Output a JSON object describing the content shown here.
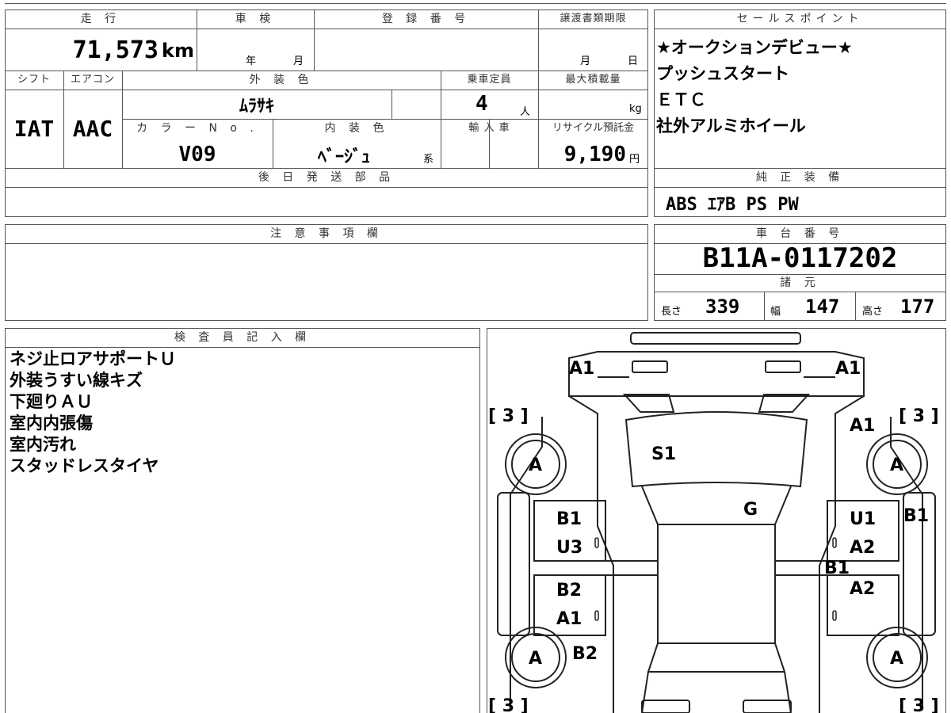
{
  "top": {
    "mileage_label": "走 行",
    "mileage_value": "71,573",
    "mileage_unit": "km",
    "inspection_label": "車 検",
    "inspection_year": "年",
    "inspection_month": "月",
    "registration_label": "登 録 番 号",
    "transfer_label": "譲渡書類期限",
    "transfer_month": "月",
    "transfer_day": "日",
    "shift_label": "シフト",
    "shift_value": "IAT",
    "ac_label": "エアコン",
    "ac_value": "AAC",
    "exterior_label": "外 装 色",
    "exterior_value": "ﾑﾗｻｷ",
    "capacity_label": "乗車定員",
    "capacity_value": "4",
    "capacity_unit": "人",
    "maxload_label": "最大積載量",
    "maxload_unit": "kg",
    "color_no_label": "カ ラ ー N o .",
    "color_no_value": "V09",
    "interior_label": "内 装 色",
    "interior_value": "ﾍﾞｰｼﾞｭ",
    "interior_suffix": "系",
    "import_label": "輸 入 車",
    "recycle_label": "リサイクル預託金",
    "recycle_value": "9,190",
    "recycle_unit": "円",
    "later_parts_label": "後 日 発 送 部 品"
  },
  "sales": {
    "label": "セールスポイント",
    "lines": [
      "★オークションデビュー★",
      "プッシュスタート",
      "ＥＴＣ",
      "社外アルミホイール"
    ]
  },
  "equipment": {
    "label": "純 正 装 備",
    "value": "ABS ｴｱB PS PW"
  },
  "notes": {
    "label": "注 意 事 項 欄"
  },
  "chassis": {
    "label": "車 台 番 号",
    "value": "B11A-0117202",
    "specs_label": "諸 元",
    "length_label": "長さ",
    "length_value": "339",
    "width_label": "幅",
    "width_value": "147",
    "height_label": "高さ",
    "height_value": "177"
  },
  "inspector": {
    "label": "検 査 員 記 入 欄",
    "lines": [
      "ネジ止ロアサポートＵ",
      "外装うすい線キズ",
      "下廻りＡＵ",
      "室内内張傷",
      "室内汚れ",
      "スタッドレスタイヤ"
    ]
  },
  "diagram": {
    "bracket_tl": "[ 3 ]",
    "bracket_tr": "[ 3 ]",
    "bracket_bl": "[ 3 ]",
    "bracket_br": "[ 3 ]",
    "wheel_fl": "A",
    "wheel_fr": "A",
    "wheel_rl": "A",
    "wheel_rr": "A",
    "marks": {
      "front_left": "A1",
      "front_right": "A1",
      "fender_right": "A1",
      "windshield": "S1",
      "roof": "G",
      "door_fl_1": "B1",
      "door_fl_2": "U3",
      "door_rl_1": "B2",
      "door_rl_2": "A1",
      "rear_left": "B2",
      "door_fr_1": "U1",
      "door_fr_2": "A2",
      "pillar_right": "B1",
      "door_rr": "A2",
      "side_right": "B1",
      "handle": "0"
    }
  }
}
